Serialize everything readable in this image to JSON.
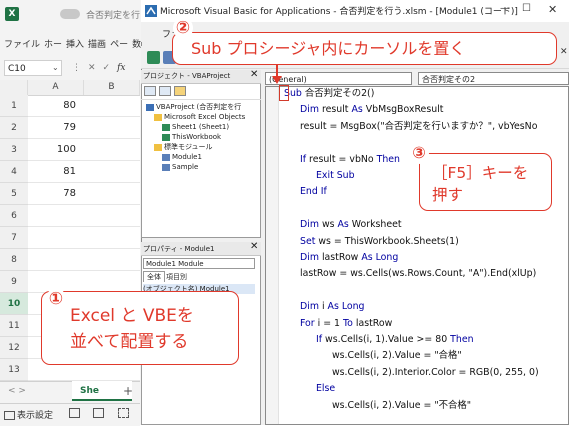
{
  "excel": {
    "title": "合否判定を行う",
    "ribbon_tabs": [
      "ファイル",
      "ホー",
      "挿入",
      "描画",
      "ペー",
      "数式"
    ],
    "name_box": "C10",
    "fx": "fx",
    "columns": [
      "A",
      "B"
    ],
    "rows": [
      {
        "num": "1",
        "a": "80"
      },
      {
        "num": "2",
        "a": "79"
      },
      {
        "num": "3",
        "a": "100"
      },
      {
        "num": "4",
        "a": "81"
      },
      {
        "num": "5",
        "a": "78"
      },
      {
        "num": "6",
        "a": ""
      },
      {
        "num": "7",
        "a": ""
      },
      {
        "num": "8",
        "a": ""
      },
      {
        "num": "9",
        "a": ""
      },
      {
        "num": "10",
        "a": ""
      },
      {
        "num": "11",
        "a": ""
      },
      {
        "num": "12",
        "a": ""
      },
      {
        "num": "13",
        "a": ""
      }
    ],
    "selected_row": "10",
    "sheet_nav": "<   >",
    "sheet_tab": "She",
    "add_sheet": "+",
    "status_text": "表示設定"
  },
  "vbe": {
    "title": "Microsoft Visual Basic for Applications - 合否判定を行う.xlsm - [Module1 (コード)]",
    "window_controls": {
      "minimize": "—",
      "maximize": "☐",
      "close": "✕"
    },
    "menu_first": "ファ",
    "project_pane": {
      "title": "プロジェクト - VBAProject",
      "close": "✕",
      "tree": [
        {
          "label": "VBAProject (合否判定を行",
          "level": 0
        },
        {
          "label": "Microsoft Excel Objects",
          "level": 1
        },
        {
          "label": "Sheet1 (Sheet1)",
          "level": 2
        },
        {
          "label": "ThisWorkbook",
          "level": 2
        },
        {
          "label": "標準モジュール",
          "level": 1
        },
        {
          "label": "Module1",
          "level": 2
        },
        {
          "label": "Sample",
          "level": 2
        }
      ]
    },
    "properties_pane": {
      "title": "プロパティ - Module1",
      "close": "✕",
      "object": "Module1 Module",
      "tab_all": "全体",
      "tab_category": "項目別",
      "row": "(オブジェクト名) Module1"
    },
    "code": {
      "combo_left": "(General)",
      "combo_right": "合否判定その2",
      "lines": [
        {
          "indent": 0,
          "parts": [
            [
              "kw",
              "Sub"
            ],
            [
              "t",
              " 合否判定その2()"
            ]
          ]
        },
        {
          "indent": 1,
          "parts": [
            [
              "kw",
              "Dim"
            ],
            [
              "t",
              " result "
            ],
            [
              "kw",
              "As"
            ],
            [
              "t",
              " VbMsgBoxResult"
            ]
          ]
        },
        {
          "indent": 1,
          "parts": [
            [
              "t",
              "result = MsgBox(\"合否判定を行いますか？\", vbYesNo"
            ]
          ]
        },
        {
          "indent": 0,
          "parts": []
        },
        {
          "indent": 1,
          "parts": [
            [
              "kw",
              "If"
            ],
            [
              "t",
              " result = vbNo "
            ],
            [
              "kw",
              "Then"
            ]
          ]
        },
        {
          "indent": 2,
          "parts": [
            [
              "kw",
              "Exit Sub"
            ]
          ]
        },
        {
          "indent": 1,
          "parts": [
            [
              "kw",
              "End If"
            ]
          ]
        },
        {
          "indent": 0,
          "parts": []
        },
        {
          "indent": 1,
          "parts": [
            [
              "kw",
              "Dim"
            ],
            [
              "t",
              " ws "
            ],
            [
              "kw",
              "As"
            ],
            [
              "t",
              " Worksheet"
            ]
          ]
        },
        {
          "indent": 1,
          "parts": [
            [
              "kw",
              "Set"
            ],
            [
              "t",
              " ws = ThisWorkbook.Sheets(1)"
            ]
          ]
        },
        {
          "indent": 1,
          "parts": [
            [
              "kw",
              "Dim"
            ],
            [
              "t",
              " lastRow "
            ],
            [
              "kw",
              "As Long"
            ]
          ]
        },
        {
          "indent": 1,
          "parts": [
            [
              "t",
              "lastRow = ws.Cells(ws.Rows.Count, \"A\").End(xlUp)"
            ]
          ]
        },
        {
          "indent": 0,
          "parts": []
        },
        {
          "indent": 1,
          "parts": [
            [
              "kw",
              "Dim"
            ],
            [
              "t",
              " i "
            ],
            [
              "kw",
              "As Long"
            ]
          ]
        },
        {
          "indent": 1,
          "parts": [
            [
              "kw",
              "For"
            ],
            [
              "t",
              " i = 1 "
            ],
            [
              "kw",
              "To"
            ],
            [
              "t",
              " lastRow"
            ]
          ]
        },
        {
          "indent": 2,
          "parts": [
            [
              "kw",
              "If"
            ],
            [
              "t",
              " ws.Cells(i, 1).Value >= 80 "
            ],
            [
              "kw",
              "Then"
            ]
          ]
        },
        {
          "indent": 3,
          "parts": [
            [
              "t",
              "ws.Cells(i, 2).Value = \"合格\""
            ]
          ]
        },
        {
          "indent": 3,
          "parts": [
            [
              "t",
              "ws.Cells(i, 2).Interior.Color = RGB(0, 255, 0)"
            ]
          ]
        },
        {
          "indent": 2,
          "parts": [
            [
              "kw",
              "Else"
            ]
          ]
        },
        {
          "indent": 3,
          "parts": [
            [
              "t",
              "ws.Cells(i, 2).Value = \"不合格\""
            ]
          ]
        }
      ]
    }
  },
  "callouts": {
    "step1_num": "②",
    "step1_text": "Sub プロシージャ内にカーソルを置く",
    "step2_num": "①",
    "step2_line1": "Excel と VBEを",
    "step2_line2": "並べて配置する",
    "step3_num": "③",
    "step3_line1": "［F5］キーを",
    "step3_line2": "押す"
  },
  "colors": {
    "excel_green": "#1f7244",
    "vba_keyword": "#0000a0",
    "callout_red": "#e0392b"
  }
}
